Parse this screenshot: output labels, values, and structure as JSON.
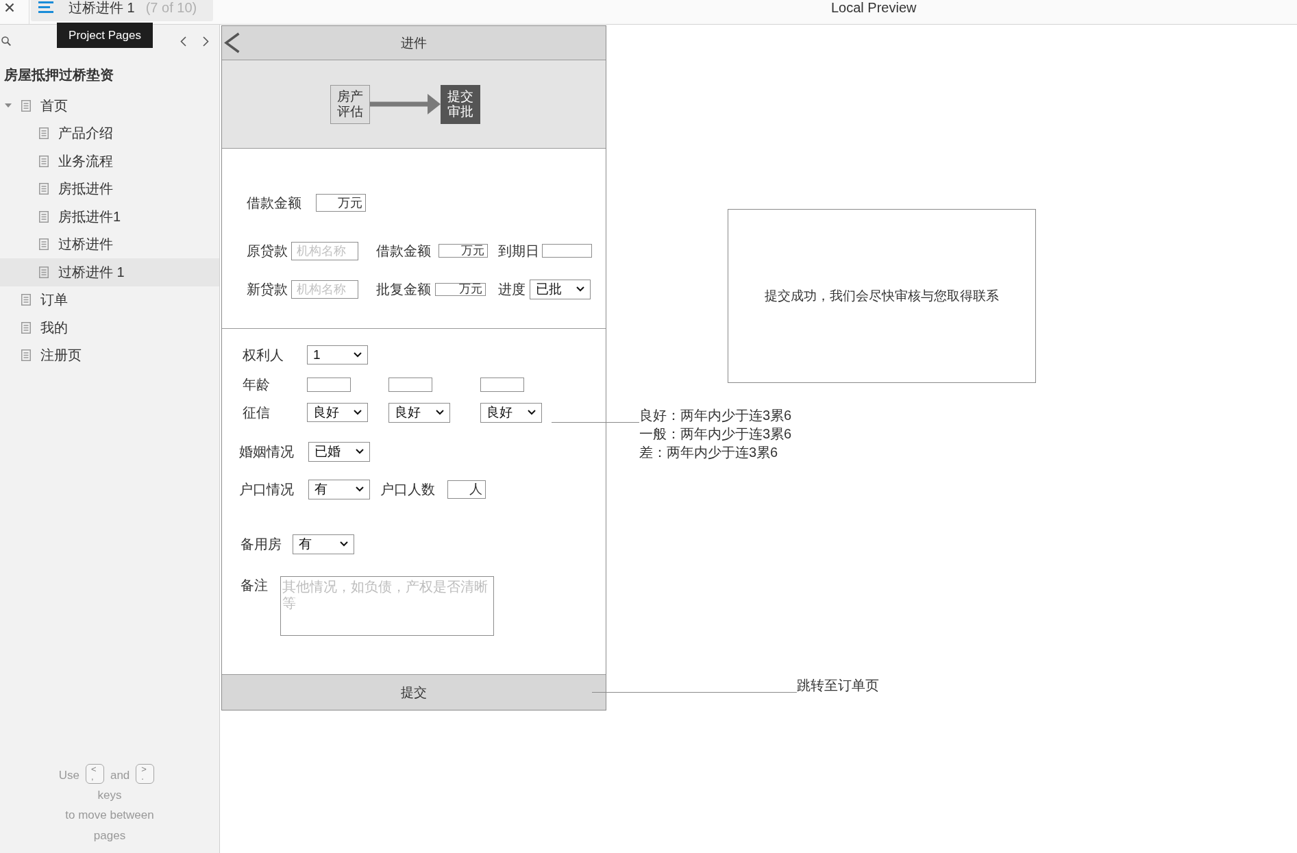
{
  "top_bar": {
    "page_title": "过桥进件 1",
    "page_position": "(7 of 10)",
    "preview_title": "Local Preview"
  },
  "tooltip": {
    "text": "Project Pages"
  },
  "sidebar": {
    "project_title": "房屋抵押过桥垫资",
    "pages": [
      {
        "label": "首页",
        "selected": false,
        "expanded": true,
        "children": [
          {
            "label": "产品介绍",
            "selected": false
          },
          {
            "label": "业务流程",
            "selected": false
          },
          {
            "label": "房抵进件",
            "selected": false
          },
          {
            "label": "房抵进件1",
            "selected": false
          },
          {
            "label": "过桥进件",
            "selected": false
          },
          {
            "label": "过桥进件 1",
            "selected": true
          }
        ]
      },
      {
        "label": "订单",
        "selected": false
      },
      {
        "label": "我的",
        "selected": false
      },
      {
        "label": "注册页",
        "selected": false
      }
    ],
    "hint": {
      "start": "Use",
      "keys": [
        {
          "top": "<",
          "bottom": ","
        },
        {
          "top": ">",
          "bottom": "."
        }
      ],
      "joiner": "and",
      "lines": [
        "keys",
        "to move between",
        "pages"
      ]
    }
  },
  "phone": {
    "title": "进件",
    "steps": [
      {
        "label": "房产评估",
        "active": false
      },
      {
        "label": "提交审批",
        "active": true
      }
    ],
    "loan": {
      "amount": {
        "label": "借款金额",
        "value": "万元"
      },
      "original": {
        "label": "原贷款",
        "placeholder": "机构名称",
        "amount_label": "借款金额",
        "amount_value": "万元",
        "due_label": "到期日"
      },
      "new": {
        "label": "新贷款",
        "placeholder": "机构名称",
        "amount_label": "批复金额",
        "amount_value": "万元",
        "progress_label": "进度",
        "progress_value": "已批"
      }
    },
    "applicant": {
      "owner_label": "权利人",
      "owner_value": "1",
      "age_label": "年龄",
      "credit_label": "征信",
      "people": [
        {
          "credit": "良好"
        },
        {
          "credit": "良好"
        },
        {
          "credit": "良好"
        }
      ]
    },
    "marital": {
      "label": "婚姻情况",
      "value": "已婚"
    },
    "hukou": {
      "label": "户口情况",
      "value": "有",
      "count_label": "户口人数",
      "count_value": "人"
    },
    "spare_house": {
      "label": "备用房",
      "value": "有"
    },
    "note": {
      "label": "备注",
      "placeholder": "其他情况，如负债，产权是否清晰等"
    },
    "submit": "提交"
  },
  "annotations": {
    "credit_legend": [
      "良好：两年内少于连3累6",
      "一般：两年内少于连3累6",
      "差：两年内少于连3累6"
    ],
    "submit_note": "跳转至订单页"
  },
  "success_dialog": {
    "message": "提交成功，我们会尽快审核与您取得联系"
  }
}
